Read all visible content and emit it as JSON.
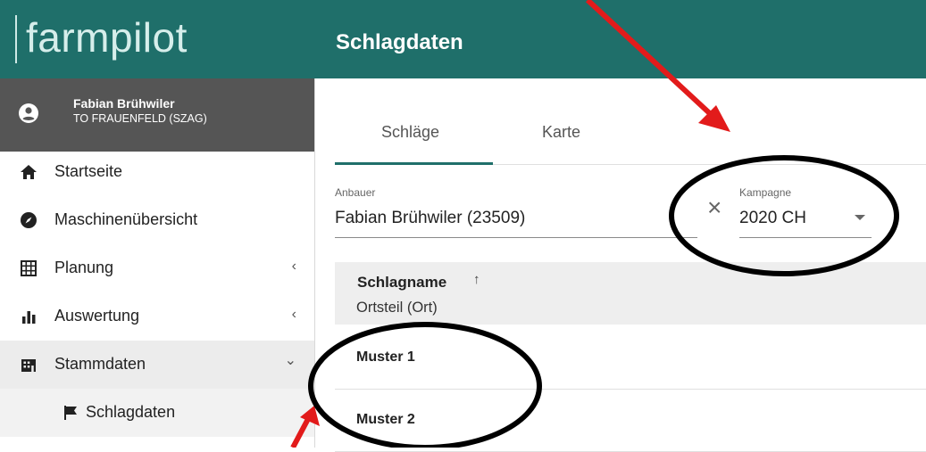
{
  "brand": {
    "name": "farmpilot"
  },
  "user": {
    "name": "Fabian Brühwiler",
    "org": "TO FRAUENFELD (SZAG)"
  },
  "nav": {
    "items": [
      {
        "label": "Startseite",
        "icon": "home-icon"
      },
      {
        "label": "Maschinenübersicht",
        "icon": "compass-icon"
      },
      {
        "label": "Planung",
        "icon": "grid-icon",
        "chevron": "‹"
      },
      {
        "label": "Auswertung",
        "icon": "bar-chart-icon",
        "chevron": "‹"
      },
      {
        "label": "Stammdaten",
        "icon": "building-icon",
        "chevron": "⌄"
      },
      {
        "label": "Schlagdaten",
        "icon": "flag-icon"
      }
    ]
  },
  "header": {
    "title": "Schlagdaten"
  },
  "tabs": [
    {
      "label": "Schläge"
    },
    {
      "label": "Karte"
    }
  ],
  "filters": {
    "anbauer_label": "Anbauer",
    "anbauer_value": "Fabian Brühwiler (23509)",
    "kampagne_label": "Kampagne",
    "kampagne_value": "2020 CH"
  },
  "table": {
    "header_title": "Schlagname",
    "sort_symbol": "↑",
    "header_sub": "Ortsteil (Ort)",
    "rows": [
      {
        "name": "Muster 1"
      },
      {
        "name": "Muster 2"
      }
    ]
  },
  "colors": {
    "brand": "#1f6f6a",
    "annotation_red": "#e21b1b"
  }
}
